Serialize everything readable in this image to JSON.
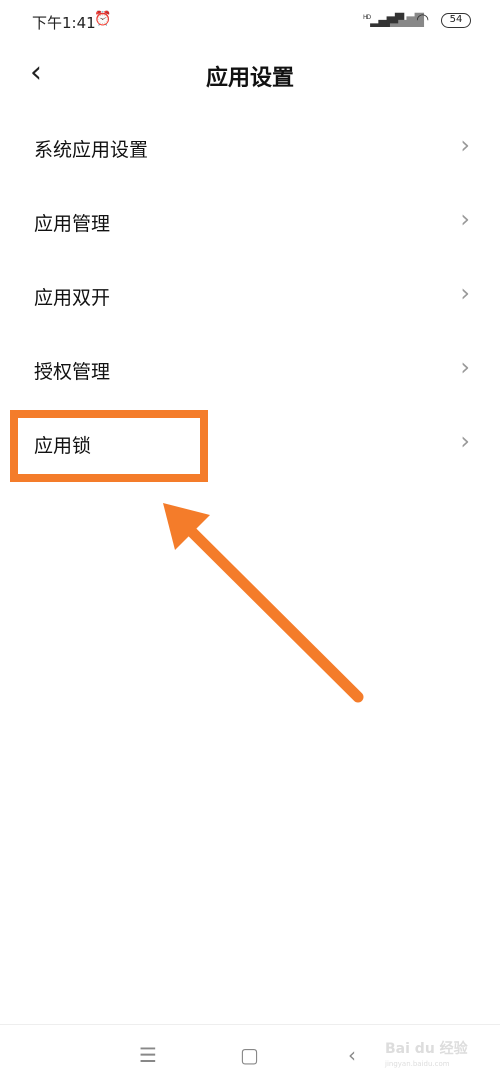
{
  "status_bar": {
    "time": "下午1:41",
    "signal_label": "HD",
    "battery": "54"
  },
  "header": {
    "title": "应用设置"
  },
  "items": [
    {
      "label": "系统应用设置"
    },
    {
      "label": "应用管理"
    },
    {
      "label": "应用双开"
    },
    {
      "label": "授权管理"
    },
    {
      "label": "应用锁"
    }
  ],
  "annotation": {
    "color": "#f47c2a",
    "highlighted_item": "应用锁"
  },
  "watermark": {
    "brand": "Bai du 经验",
    "url": "jingyan.baidu.com"
  }
}
